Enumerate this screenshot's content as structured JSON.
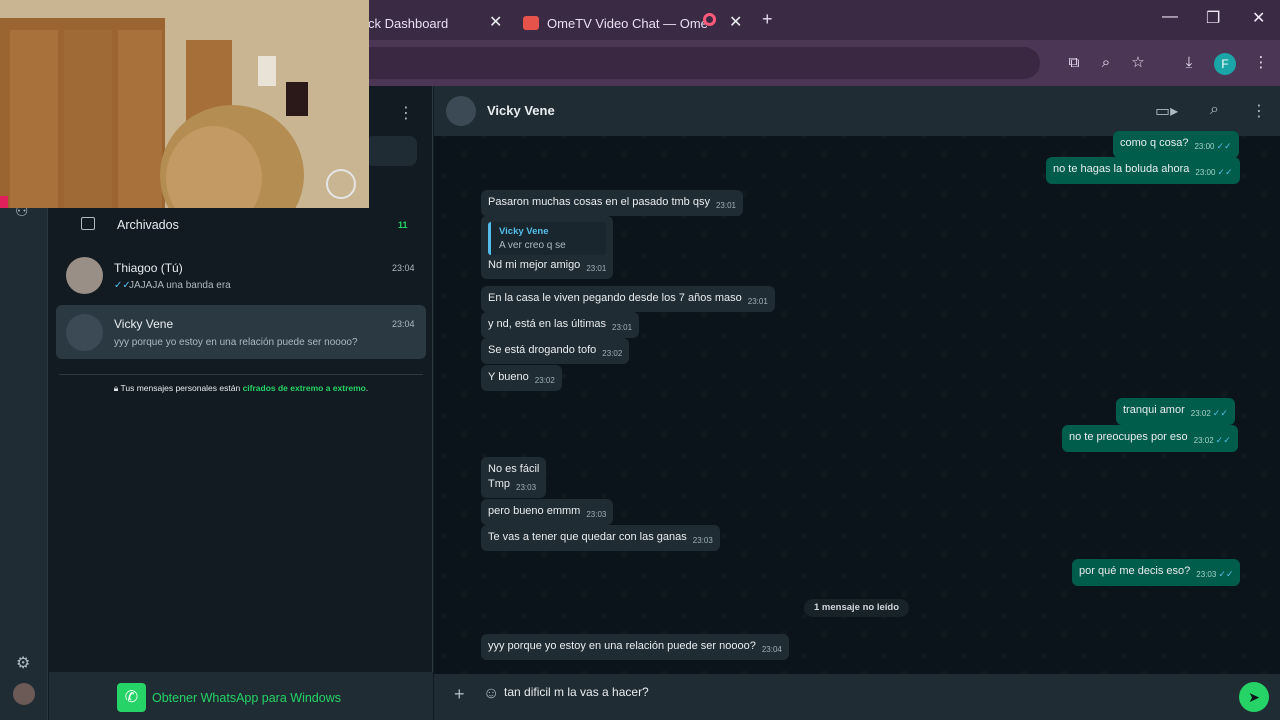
{
  "browser": {
    "tabs": [
      {
        "title": "ck Dashboard"
      },
      {
        "title": "OmeTV Video Chat — Ome"
      }
    ],
    "profile_initial": "F"
  },
  "sidebar": {
    "archived_label": "Archivados",
    "archived_count": "11",
    "chats": [
      {
        "name": "Thiagoo (Tú)",
        "preview": "JAJAJA una banda era",
        "time": "23:04"
      },
      {
        "name": "Vicky Vene",
        "preview": "yyy porque yo estoy en una relación puede ser noooo?",
        "time": "23:04"
      }
    ],
    "encryption_prefix": "Tus mensajes personales están ",
    "encryption_link": "cifrados de extremo a extremo",
    "encryption_suffix": ".",
    "get_app": "Obtener WhatsApp para Windows"
  },
  "chat": {
    "contact_name": "Vicky Vene",
    "messages": [
      {
        "dir": "out",
        "text": "como q cosa?",
        "time": "23:00"
      },
      {
        "dir": "out",
        "text": "no te hagas la boluda ahora",
        "time": "23:00"
      },
      {
        "dir": "in",
        "text": "Pasaron muchas cosas en el pasado tmb qsy",
        "time": "23:01"
      },
      {
        "dir": "in",
        "quote_name": "Vicky Vene",
        "quote_text": "A ver creo q se",
        "text": "Nd mi mejor amigo",
        "time": "23:01"
      },
      {
        "dir": "in",
        "text": "En la casa le viven pegando desde los 7 años maso",
        "time": "23:01"
      },
      {
        "dir": "in",
        "text": "y nd, está en las últimas",
        "time": "23:01"
      },
      {
        "dir": "in",
        "text": "Se está drogando tofo",
        "time": "23:02"
      },
      {
        "dir": "in",
        "text": "Y bueno",
        "time": "23:02"
      },
      {
        "dir": "out",
        "text": "tranqui amor",
        "time": "23:02"
      },
      {
        "dir": "out",
        "text": "no te preocupes por eso",
        "time": "23:02"
      },
      {
        "dir": "in",
        "text_line1": "No es fácil",
        "text": "Tmp",
        "time": "23:03"
      },
      {
        "dir": "in",
        "text": "pero bueno emmm",
        "time": "23:03"
      },
      {
        "dir": "in",
        "text": "Te vas a tener que quedar con las ganas",
        "time": "23:03"
      },
      {
        "dir": "out",
        "text": "por qué me decis eso?",
        "time": "23:03"
      },
      {
        "dir": "in",
        "text": "yyy porque yo estoy en una relación puede ser noooo?",
        "time": "23:04"
      }
    ],
    "unread_label": "1 mensaje no leído",
    "composer_text": "tan dificil m la vas a hacer?"
  },
  "colors": {
    "accent": "#25d366",
    "outgoing": "#005c4b",
    "incoming": "#202c33",
    "tick": "#53bdeb"
  },
  "icons": [
    "plus-icon",
    "emoji-icon",
    "send-icon",
    "search-icon",
    "video-icon",
    "menu-dots-icon",
    "settings-icon",
    "archive-icon",
    "lock-icon",
    "whatsapp-icon",
    "download-icon",
    "star-icon",
    "zoom-icon"
  ]
}
